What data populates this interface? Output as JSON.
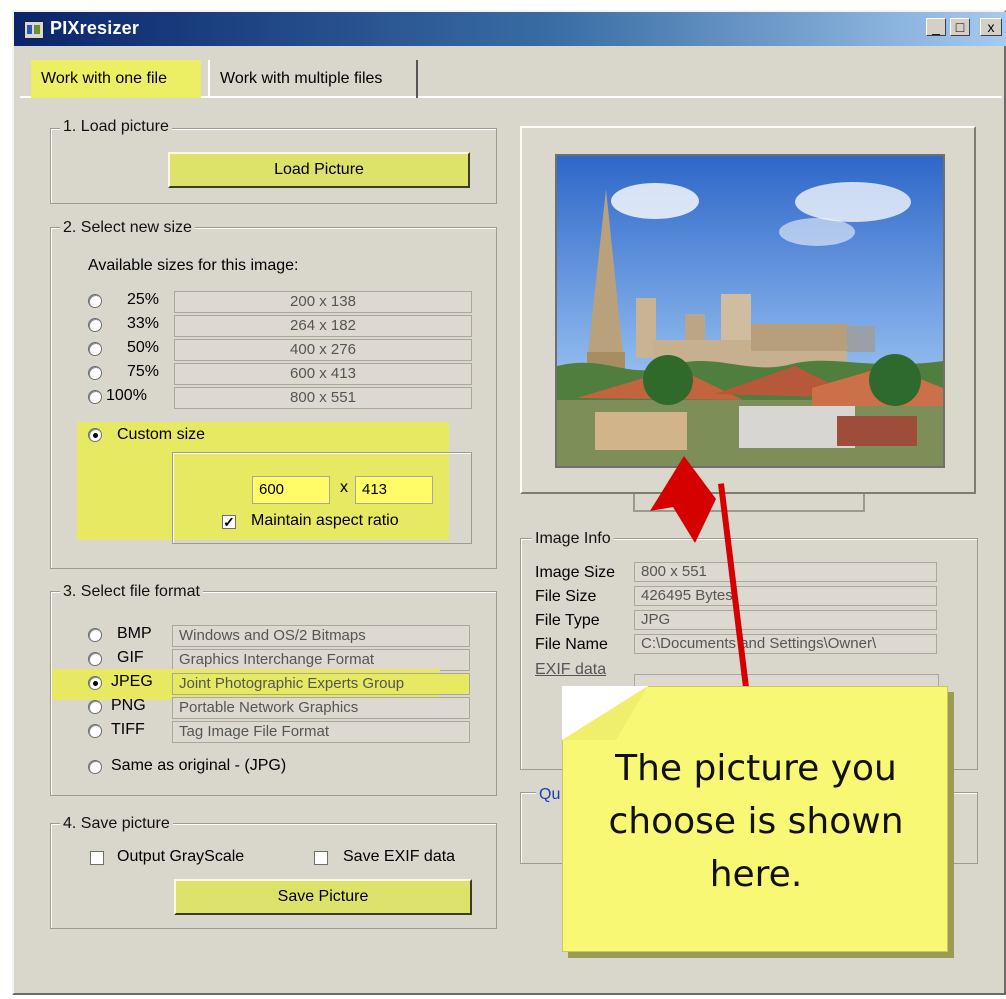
{
  "window": {
    "title": "PIXresizer",
    "controls": [
      "_",
      "□",
      "x"
    ]
  },
  "tabs": [
    {
      "label": "Work with one file",
      "active": true
    },
    {
      "label": "Work with multiple files",
      "active": false
    }
  ],
  "sections": {
    "load": {
      "title": "1. Load picture",
      "button": "Load Picture"
    },
    "size": {
      "title": "2. Select new size",
      "available_label": "Available sizes for this image:",
      "options": [
        {
          "percent": "25%",
          "size": "200 x 138"
        },
        {
          "percent": "33%",
          "size": "264 x 182"
        },
        {
          "percent": "50%",
          "size": "400 x 276"
        },
        {
          "percent": "75%",
          "size": "600 x 413"
        },
        {
          "percent": "100%",
          "size": "800 x 551"
        }
      ],
      "custom_label": "Custom size",
      "width": "600",
      "height": "413",
      "times": "x",
      "maintain_aspect_label": "Maintain aspect ratio"
    },
    "format": {
      "title": "3. Select file format",
      "options": [
        {
          "name": "BMP",
          "desc": "Windows and OS/2 Bitmaps",
          "selected": false
        },
        {
          "name": "GIF",
          "desc": "Graphics Interchange Format",
          "selected": false
        },
        {
          "name": "JPEG",
          "desc": "Joint Photographic Experts Group",
          "selected": true
        },
        {
          "name": "PNG",
          "desc": "Portable Network Graphics",
          "selected": false
        },
        {
          "name": "TIFF",
          "desc": "Tag Image File Format",
          "selected": false
        }
      ],
      "same_as_original": "Same as original - (JPG)"
    },
    "save": {
      "title": "4. Save picture",
      "grayscale_label": "Output GrayScale",
      "save_exif_label": "Save EXIF data",
      "button": "Save Picture"
    }
  },
  "image_info": {
    "title": "Image Info",
    "rows": [
      {
        "label": "Image Size",
        "value": "800 x 551"
      },
      {
        "label": "File Size",
        "value": "426495 Bytes"
      },
      {
        "label": "File Type",
        "value": "JPG"
      },
      {
        "label": "File Name",
        "value": "C:\\Documents and Settings\\Owner\\"
      }
    ],
    "exif_link": "EXIF data"
  },
  "quality": {
    "label": "Qu"
  },
  "callout": {
    "text": "The picture you choose is shown here."
  },
  "colors": {
    "highlight": "#ecee63",
    "arrow": "#d50000",
    "note": "#f9f874"
  }
}
